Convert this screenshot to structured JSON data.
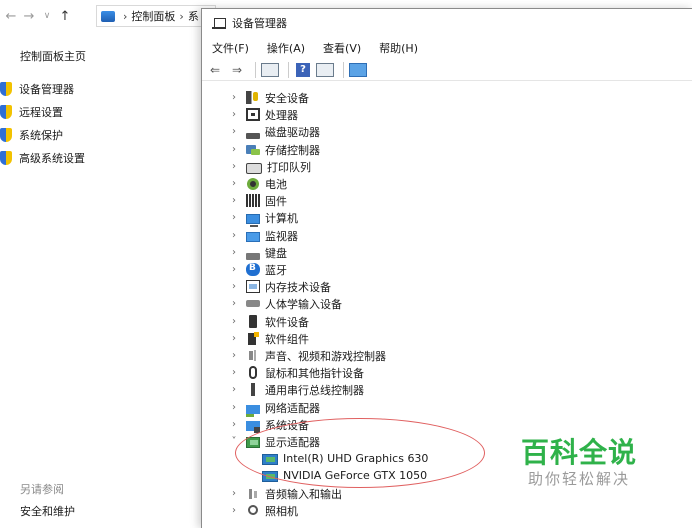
{
  "control_panel": {
    "breadcrumb_root": "控制面板",
    "breadcrumb_next": "系",
    "home_link": "控制面板主页",
    "links": [
      "设备管理器",
      "远程设置",
      "系统保护",
      "高级系统设置"
    ],
    "see_also": "另请参阅",
    "safety_link": "安全和维护"
  },
  "device_manager": {
    "title": "设备管理器",
    "menu": [
      "文件(F)",
      "操作(A)",
      "查看(V)",
      "帮助(H)"
    ],
    "toolbar_icons": [
      "back-arrow-icon",
      "forward-arrow-icon",
      "properties-icon",
      "help-icon",
      "details-icon",
      "monitor-icon"
    ],
    "tree": [
      {
        "label": "安全设备",
        "icon": "security-device-icon",
        "expanded": false
      },
      {
        "label": "处理器",
        "icon": "processor-icon",
        "expanded": false
      },
      {
        "label": "磁盘驱动器",
        "icon": "disk-drive-icon",
        "expanded": false
      },
      {
        "label": "存储控制器",
        "icon": "storage-controller-icon",
        "expanded": false
      },
      {
        "label": "打印队列",
        "icon": "print-queue-icon",
        "expanded": false
      },
      {
        "label": "电池",
        "icon": "battery-icon",
        "expanded": false
      },
      {
        "label": "固件",
        "icon": "firmware-icon",
        "expanded": false
      },
      {
        "label": "计算机",
        "icon": "computer-icon",
        "expanded": false
      },
      {
        "label": "监视器",
        "icon": "monitor-icon",
        "expanded": false
      },
      {
        "label": "键盘",
        "icon": "keyboard-icon",
        "expanded": false
      },
      {
        "label": "蓝牙",
        "icon": "bluetooth-icon",
        "expanded": false
      },
      {
        "label": "内存技术设备",
        "icon": "memory-technology-icon",
        "expanded": false
      },
      {
        "label": "人体学输入设备",
        "icon": "hid-icon",
        "expanded": false
      },
      {
        "label": "软件设备",
        "icon": "software-device-icon",
        "expanded": false
      },
      {
        "label": "软件组件",
        "icon": "software-component-icon",
        "expanded": false
      },
      {
        "label": "声音、视频和游戏控制器",
        "icon": "sound-video-icon",
        "expanded": false
      },
      {
        "label": "鼠标和其他指针设备",
        "icon": "mouse-icon",
        "expanded": false
      },
      {
        "label": "通用串行总线控制器",
        "icon": "usb-controller-icon",
        "expanded": false
      },
      {
        "label": "网络适配器",
        "icon": "network-adapter-icon",
        "expanded": false
      },
      {
        "label": "系统设备",
        "icon": "system-device-icon",
        "expanded": false
      },
      {
        "label": "显示适配器",
        "icon": "display-adapter-icon",
        "expanded": true,
        "children": [
          "Intel(R) UHD Graphics 630",
          "NVIDIA GeForce GTX 1050"
        ]
      },
      {
        "label": "音频输入和输出",
        "icon": "audio-io-icon",
        "expanded": false
      },
      {
        "label": "照相机",
        "icon": "camera-icon",
        "expanded": false
      }
    ]
  },
  "watermark": {
    "title": "百科全说",
    "subtitle": "助你轻松解决"
  },
  "colors": {
    "annotation_ellipse": "#e06060",
    "watermark_green": "#2fb24a"
  }
}
